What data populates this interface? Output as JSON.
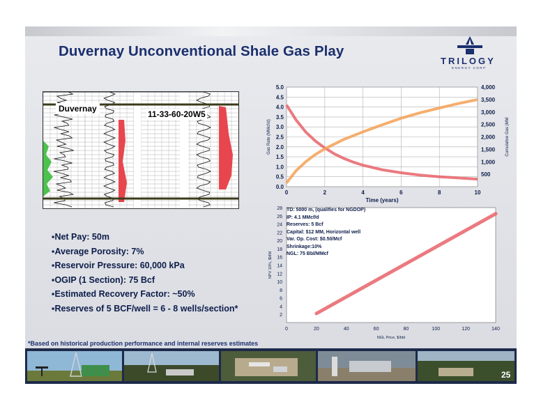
{
  "slide": {
    "title": "Duvernay Unconventional Shale Gas Play",
    "logo": {
      "word": "TRILOGY",
      "sub": "ENERGY CORP"
    },
    "page_number": "25",
    "footnote": "*Based on historical production performance and internal reserves estimates"
  },
  "well_log": {
    "formation_label": "Duvernay",
    "well_label": "11-33-60-20W5"
  },
  "bullets": [
    "Net Pay: 50m",
    "Average Porosity: 7%",
    "Reservoir Pressure: 60,000 kPa",
    "OGIP (1 Section): 75 Bcf",
    "Estimated Recovery Factor: ~50%",
    "Reserves of 5 BCF/well = 6 - 8 wells/section*"
  ],
  "photos": [
    "oilfield-pumpjack-photo",
    "drilling-rig-photo",
    "aerial-facility-photo",
    "gas-plant-photo",
    "wellsite-photo"
  ],
  "colors": {
    "title": "#1b2f6e",
    "line_red": "#e8636a",
    "line_orange": "#f4a055",
    "chart_bg": "#ffffff"
  },
  "chart_data": [
    {
      "type": "line",
      "xlabel": "Time (years)",
      "ylabel": "Gas Rate (MMcf/d)",
      "y2label": "Cumulative Gas (MM",
      "x_ticks": [
        0,
        2,
        4,
        6,
        8,
        10
      ],
      "y_ticks": [
        "0.0",
        "0.5",
        "1.0",
        "1.5",
        "2.0",
        "2.5",
        "3.0",
        "3.5",
        "4.0",
        "4.5",
        "5.0"
      ],
      "y2_ticks": [
        "500",
        "1,000",
        "1,500",
        "2,000",
        "2,500",
        "3,000",
        "3,500",
        "4,000"
      ],
      "xlim": [
        0,
        10
      ],
      "ylim": [
        0,
        5
      ],
      "y2lim": [
        0,
        4000
      ],
      "series": [
        {
          "axis": "left",
          "color": "#e8636a",
          "x": [
            0,
            0.5,
            1,
            1.5,
            2,
            2.5,
            3,
            3.5,
            4,
            5,
            6,
            7,
            8,
            9,
            10
          ],
          "y": [
            4.1,
            3.35,
            2.75,
            2.3,
            1.95,
            1.65,
            1.42,
            1.23,
            1.08,
            0.85,
            0.7,
            0.58,
            0.5,
            0.44,
            0.38
          ]
        },
        {
          "axis": "right",
          "color": "#f4a055",
          "x": [
            0,
            0.5,
            1,
            1.5,
            2,
            3,
            4,
            5,
            6,
            7,
            8,
            9,
            10
          ],
          "y": [
            150,
            640,
            1000,
            1290,
            1520,
            1900,
            2200,
            2480,
            2750,
            2970,
            3160,
            3340,
            3500
          ]
        }
      ]
    },
    {
      "type": "line",
      "xlabel": "NGL Price, $/bbl",
      "ylabel": "NPV 10%, $MM",
      "x_ticks": [
        0,
        20,
        40,
        60,
        80,
        100,
        120,
        140
      ],
      "y_ticks": [
        2,
        4,
        6,
        8,
        10,
        12,
        14,
        16,
        18,
        20,
        22,
        24,
        26,
        28
      ],
      "xlim": [
        0,
        140
      ],
      "ylim": [
        0,
        28
      ],
      "annotations": [
        "TD: 5000 m, (qualifies for NGDOP)",
        "IP: 4.1 MMcf/d",
        "Reserves: 5 Bcf",
        "Capital: $12 MM, Horizontal well",
        "Var. Op. Cost: $0.50/Mcf",
        "Shrinkage:10%",
        "NGL: 75 Bbl/MMcf"
      ],
      "series": [
        {
          "color": "#e8636a",
          "x": [
            20,
            140
          ],
          "y": [
            2.2,
            26.5
          ]
        }
      ]
    }
  ]
}
